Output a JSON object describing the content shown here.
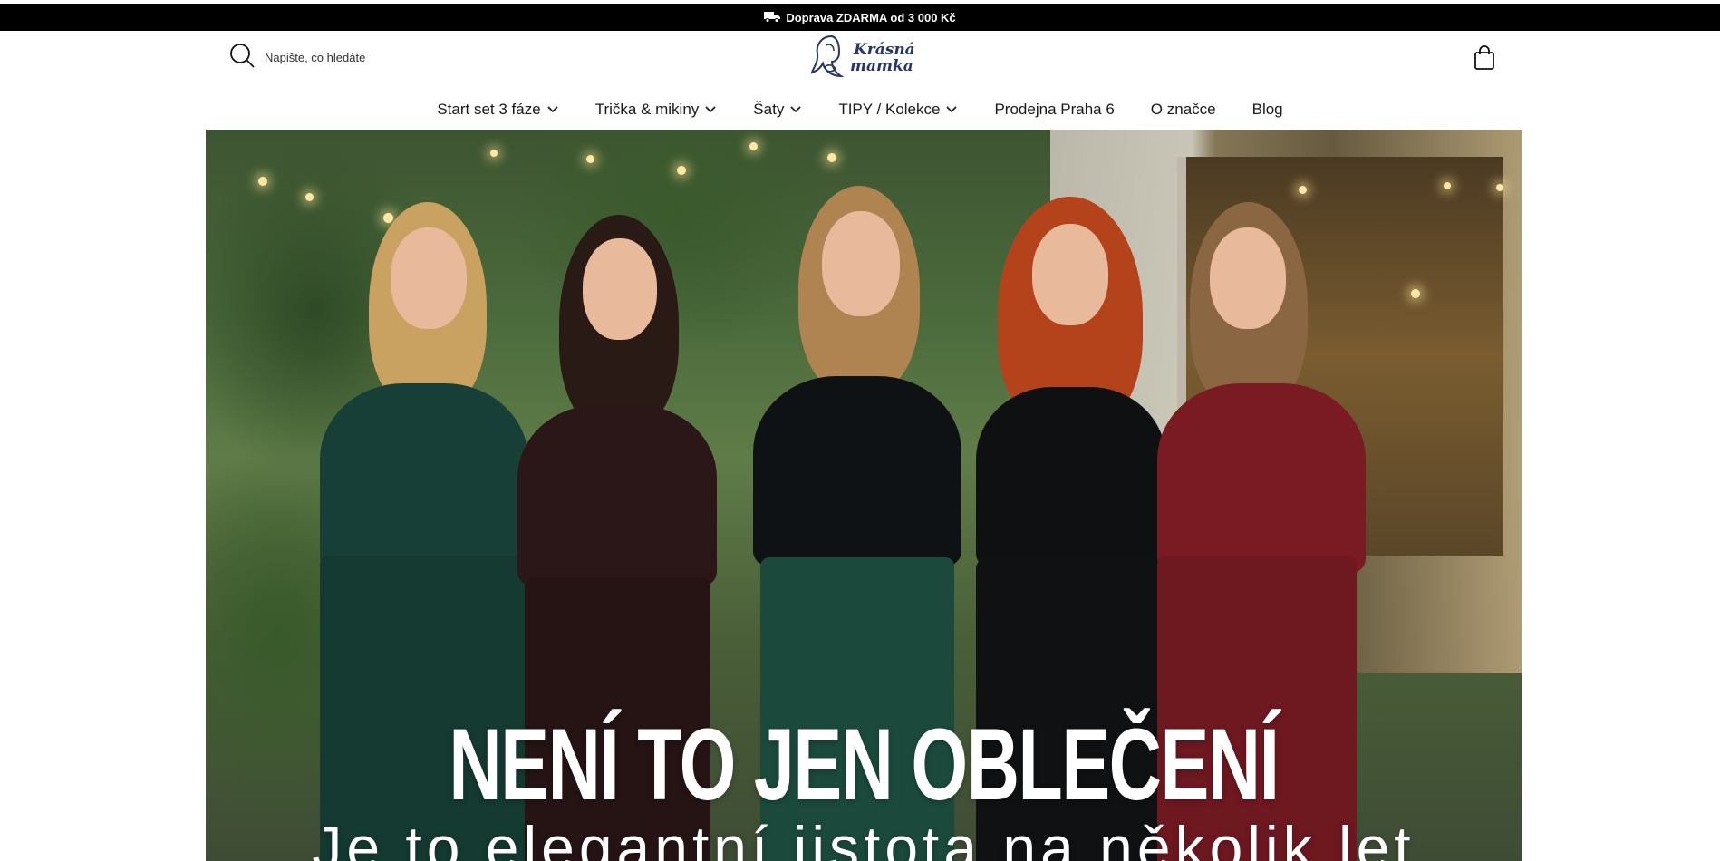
{
  "announcement": {
    "icon": "truck-icon",
    "text": "Doprava ZDARMA od 3 000 Kč"
  },
  "header": {
    "search": {
      "icon": "search-icon",
      "placeholder": "Napište, co hledáte"
    },
    "logo": {
      "line1": "Krásná",
      "line2": "mamka",
      "icon": "mother-silhouette-logo",
      "color": "#27356a"
    },
    "cart": {
      "icon": "shopping-bag-icon"
    }
  },
  "nav": {
    "items": [
      {
        "label": "Start set 3 fáze",
        "dropdown": true
      },
      {
        "label": "Trička & mikiny",
        "dropdown": true
      },
      {
        "label": "Šaty",
        "dropdown": true
      },
      {
        "label": "TIPY / Kolekce",
        "dropdown": true
      },
      {
        "label": "Prodejna Praha 6",
        "dropdown": false
      },
      {
        "label": "O značce",
        "dropdown": false
      },
      {
        "label": "Blog",
        "dropdown": false
      }
    ]
  },
  "hero": {
    "title": "NENÍ TO JEN OBLEČENÍ",
    "subtitle": "Je to elegantní jistota na několik let",
    "dress_colors": [
      "#173f37",
      "#2b1718",
      "#0f1214",
      "#0e1012",
      "#7a1a22"
    ]
  }
}
